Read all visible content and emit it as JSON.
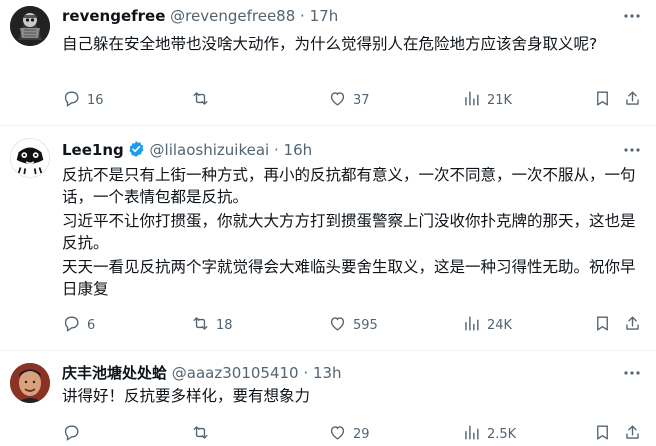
{
  "tweets": [
    {
      "display_name": "revengefree",
      "handle": "@revengefree88",
      "time": "17h",
      "verified": false,
      "body": [
        "自己躲在安全地带也没啥大动作，为什么觉得别人在危险地方应该舍身取义呢?"
      ],
      "replies": "16",
      "retweets": "",
      "likes": "37",
      "views": "21K"
    },
    {
      "display_name": "Lee1ng",
      "handle": "@lilaoshizuikeai",
      "time": "16h",
      "verified": true,
      "body": [
        "反抗不是只有上街一种方式，再小的反抗都有意义，一次不同意，一次不服从，一句话，一个表情包都是反抗。",
        "习近平不让你打掼蛋，你就大大方方打到掼蛋警察上门没收你扑克牌的那天，这也是反抗。",
        "天天一看见反抗两个字就觉得会大难临头要舍生取义，这是一种习得性无助。祝你早日康复"
      ],
      "replies": "6",
      "retweets": "18",
      "likes": "595",
      "views": "24K"
    },
    {
      "display_name": "庆丰池塘处处蛤",
      "handle": "@aaaz30105410",
      "time": "13h",
      "verified": false,
      "body": [
        "讲得好！反抗要多样化，要有想象力"
      ],
      "replies": "",
      "retweets": "",
      "likes": "29",
      "views": "2.5K"
    }
  ],
  "separator": "·",
  "colors": {
    "verified": "#1d9bf0",
    "muted": "#536471",
    "text": "#0f1419"
  },
  "icons": [
    "reply-icon",
    "retweet-icon",
    "like-icon",
    "views-icon",
    "bookmark-icon",
    "share-icon",
    "more-icon",
    "verified-icon"
  ]
}
